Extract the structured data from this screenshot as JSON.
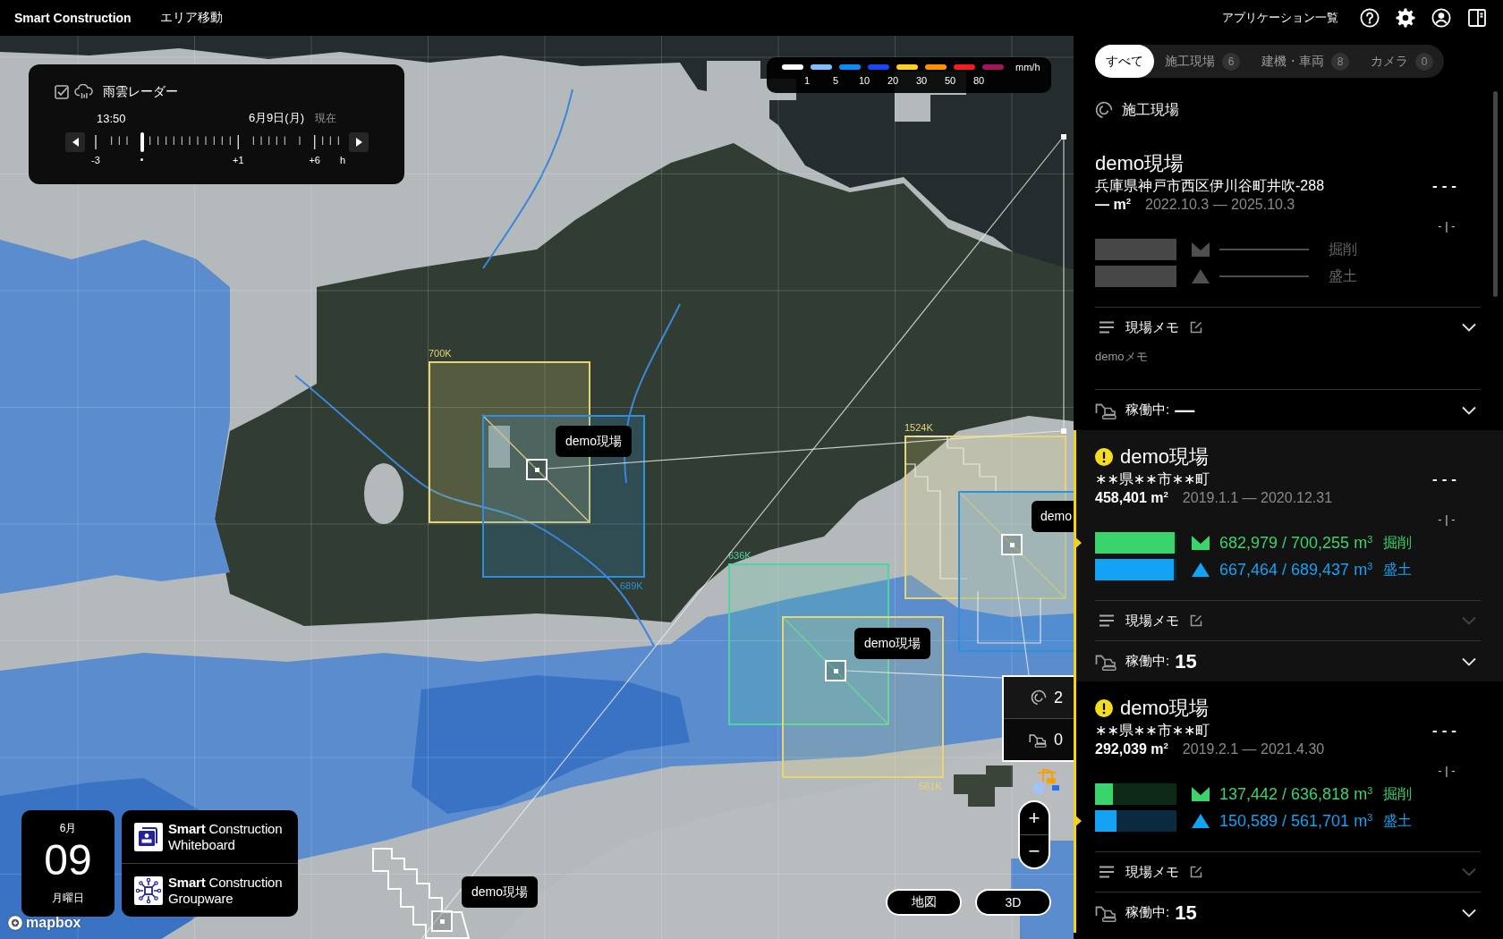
{
  "header": {
    "brand": "Smart Construction",
    "menu": "エリア移動",
    "apps": "アプリケーション一覧"
  },
  "radar": {
    "checked": true,
    "title": "雨雲レーダー",
    "time": "13:50",
    "date": "6月9日(月)",
    "now": "現在",
    "level": 0.19,
    "ticks": [
      "-3",
      "+1",
      "+6",
      "h"
    ]
  },
  "legend": {
    "swatches": [
      {
        "color": "#ffffff"
      },
      {
        "color": "#80bfff"
      },
      {
        "color": "#0a8cf5"
      },
      {
        "color": "#1a46f5"
      },
      {
        "color": "#fad21e"
      },
      {
        "color": "#ff9100"
      },
      {
        "color": "#f51e1e"
      },
      {
        "color": "#a0185a"
      }
    ],
    "values": [
      "1",
      "5",
      "10",
      "20",
      "30",
      "50",
      "80"
    ],
    "unit": "mm/h"
  },
  "map": {
    "areas": [
      {
        "label": "700K",
        "color": "#e6d574"
      },
      {
        "label": "689K",
        "color": "#2e8fdc"
      },
      {
        "label": "1524K",
        "color": "#e6d574"
      },
      {
        "color": "#2e8fdc"
      },
      {
        "label": "636K",
        "color": "#4fd3a2"
      },
      {
        "label": "561K",
        "color": "#e6d574"
      },
      {
        "color": "#ffffff"
      }
    ],
    "markers": [
      {
        "label": "demo現場"
      },
      {
        "label": "demo"
      },
      {
        "label": "demo現場"
      },
      {
        "label": "demo現場"
      }
    ],
    "cluster": {
      "sites": "2",
      "machines": "0"
    },
    "zoom": {
      "in": "+",
      "out": "−"
    },
    "views": [
      {
        "label": "地図",
        "selected": false
      },
      {
        "label": "3D",
        "selected": false
      }
    ],
    "attribution": "mapbox"
  },
  "date": {
    "month": "6月",
    "day": "09",
    "weekday": "月曜日"
  },
  "apps": [
    {
      "kind": "whiteboard",
      "brand": "**Smart** Construction",
      "product": "Whiteboard"
    },
    {
      "kind": "groupware",
      "brand": "**Smart** Construction",
      "product": "Groupware"
    }
  ],
  "panel": {
    "tabs": [
      {
        "label": "すべて",
        "selected": true
      },
      {
        "label": "施工現場",
        "count": "6",
        "selected": false
      },
      {
        "label": "建機・車両",
        "count": "8",
        "selected": false
      },
      {
        "label": "カメラ",
        "count": "0",
        "selected": false
      }
    ],
    "section": "施工現場",
    "sites": [
      {
        "name": "demo現場",
        "warning": false,
        "selected": false,
        "address": "兵庫県神戸市西区伊川谷町井吹-288",
        "area": "— m$^{2}$",
        "period": "2022.10.3 — 2025.10.3",
        "status": "---",
        "ratio": "- | -",
        "metrics": [
          {
            "kind": "cut",
            "label": "掘削",
            "flagged": false
          },
          {
            "kind": "fill",
            "label": "盛土",
            "flagged": false
          }
        ],
        "memo": {
          "label": "現場メモ",
          "disabled": false,
          "text": "demoメモ"
        },
        "operating": {
          "label": "稼働中:",
          "value": "—"
        }
      },
      {
        "name": "demo現場",
        "warning": true,
        "selected": true,
        "address": "∗∗県∗∗市∗∗町",
        "area": "458,401 m$^{2}$",
        "period": "2019.1.1 — 2020.12.31",
        "status": "---",
        "ratio": "- | -",
        "metrics": [
          {
            "kind": "cut",
            "value": "682,979 / 700,255 m$^{3}$",
            "label": "掘削",
            "level": 0.975,
            "flagged": true
          },
          {
            "kind": "fill",
            "value": "667,464 / 689,437 m$^{3}$",
            "label": "盛土",
            "level": 0.968,
            "flagged": false
          }
        ],
        "memo": {
          "label": "現場メモ",
          "disabled": true
        },
        "operating": {
          "label": "稼働中:",
          "value": "15"
        }
      },
      {
        "name": "demo現場",
        "warning": true,
        "selected": false,
        "address": "∗∗県∗∗市∗∗町",
        "area": "292,039 m$^{2}$",
        "period": "2019.2.1 — 2021.4.30",
        "status": "---",
        "ratio": "- | -",
        "metrics": [
          {
            "kind": "cut",
            "value": "137,442 / 636,818 m$^{3}$",
            "label": "掘削",
            "level": 0.216,
            "flagged": false
          },
          {
            "kind": "fill",
            "value": "150,589 / 561,701 m$^{3}$",
            "label": "盛土",
            "level": 0.268,
            "flagged": true
          }
        ],
        "memo": {
          "label": "現場メモ",
          "disabled": true
        },
        "operating": {
          "label": "稼働中:",
          "value": "15"
        }
      }
    ]
  }
}
